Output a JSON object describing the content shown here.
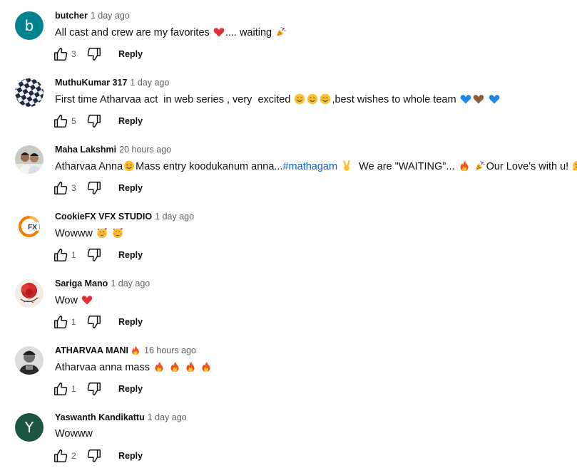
{
  "comments": [
    {
      "author": "butcher",
      "time": "1 day ago",
      "avatar": {
        "type": "letter",
        "letter": "b",
        "color": "#00838f"
      },
      "text_parts": [
        {
          "t": "All cast and crew are my favorites "
        },
        {
          "emoji": "heart"
        },
        {
          "t": ".... waiting "
        },
        {
          "emoji": "party"
        }
      ],
      "likes": "3",
      "reply_label": "Reply"
    },
    {
      "author": "MuthuKumar 317",
      "time": "1 day ago",
      "avatar": {
        "type": "checker"
      },
      "text_parts": [
        {
          "t": "First time Atharvaa act  in web series , very  excited "
        },
        {
          "emoji": "smile"
        },
        {
          "emoji": "smile"
        },
        {
          "emoji": "smile"
        },
        {
          "t": ",best wishes to whole team "
        },
        {
          "emoji": "blue-heart"
        },
        {
          "emoji": "brown-heart"
        },
        {
          "t": " "
        },
        {
          "emoji": "blue-heart"
        }
      ],
      "likes": "5",
      "reply_label": "Reply"
    },
    {
      "author": "Maha Lakshmi",
      "time": "20 hours ago",
      "avatar": {
        "type": "photo-couple"
      },
      "text_parts": [
        {
          "t": "Atharvaa Anna"
        },
        {
          "emoji": "wink"
        },
        {
          "t": "Mass entry koodukanum anna..."
        },
        {
          "hashtag": "#mathagam"
        },
        {
          "t": " "
        },
        {
          "emoji": "victory"
        },
        {
          "t": "  We are \"WAITING\"... "
        },
        {
          "emoji": "fire"
        },
        {
          "t": " "
        },
        {
          "emoji": "party"
        },
        {
          "t": "Our Love's with u! "
        },
        {
          "emoji": "hug"
        }
      ],
      "likes": "3",
      "reply_label": "Reply"
    },
    {
      "author": "CookieFX VFX STUDIO",
      "time": "1 day ago",
      "avatar": {
        "type": "logo-fx",
        "logo_text": "FX"
      },
      "text_parts": [
        {
          "t": "Wowww "
        },
        {
          "emoji": "love-face"
        },
        {
          "t": " "
        },
        {
          "emoji": "love-face"
        }
      ],
      "likes": "1",
      "reply_label": "Reply"
    },
    {
      "author": "Sariga Mano",
      "time": "1 day ago",
      "avatar": {
        "type": "photo-rose"
      },
      "text_parts": [
        {
          "t": "Wow "
        },
        {
          "emoji": "heart"
        }
      ],
      "likes": "1",
      "reply_label": "Reply"
    },
    {
      "author": "ATHARVAA MANI",
      "author_emoji": "fire",
      "time": "16 hours ago",
      "avatar": {
        "type": "photo-portrait"
      },
      "text_parts": [
        {
          "t": "Atharvaa anna mass "
        },
        {
          "emoji": "fire"
        },
        {
          "t": " "
        },
        {
          "emoji": "fire"
        },
        {
          "t": " "
        },
        {
          "emoji": "fire"
        },
        {
          "t": " "
        },
        {
          "emoji": "fire"
        }
      ],
      "likes": "1",
      "reply_label": "Reply"
    },
    {
      "author": "Yaswanth Kandikattu",
      "time": "1 day ago",
      "avatar": {
        "type": "letter",
        "letter": "Y",
        "color": "#1e5540"
      },
      "text_parts": [
        {
          "t": "Wowww"
        }
      ],
      "likes": "2",
      "reply_label": "Reply"
    }
  ]
}
